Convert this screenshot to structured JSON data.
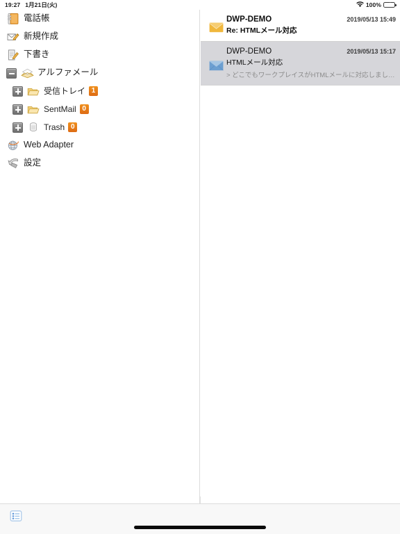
{
  "statusbar": {
    "time": "19:27",
    "date": "1月21日(火)",
    "wifi_icon": "wifi-icon",
    "battery_percent": "100%",
    "battery_icon": "battery-charging-icon"
  },
  "sidebar": {
    "items": [
      {
        "label": "電話帳",
        "icon": "address-book-icon",
        "level": 1,
        "disclosure": null,
        "badge": null
      },
      {
        "label": "新規作成",
        "icon": "compose-mail-icon",
        "level": 1,
        "disclosure": null,
        "badge": null
      },
      {
        "label": "下書き",
        "icon": "draft-icon",
        "level": 1,
        "disclosure": null,
        "badge": null
      },
      {
        "label": "アルファメール",
        "icon": "account-mail-icon",
        "level": 1,
        "disclosure": "minus",
        "badge": null
      },
      {
        "label": "受信トレイ",
        "icon": "folder-icon",
        "level": 2,
        "disclosure": "plus",
        "badge": "1"
      },
      {
        "label": "SentMail",
        "icon": "folder-icon",
        "level": 2,
        "disclosure": "plus",
        "badge": "0"
      },
      {
        "label": "Trash",
        "icon": "trash-can-icon",
        "level": 2,
        "disclosure": "plus",
        "badge": "0"
      },
      {
        "label": "Web Adapter",
        "icon": "globe-icon",
        "level": 1,
        "disclosure": null,
        "badge": null
      },
      {
        "label": "設定",
        "icon": "settings-arrow-icon",
        "level": 1,
        "disclosure": null,
        "badge": null
      }
    ]
  },
  "mail_list": {
    "messages": [
      {
        "from": "DWP-DEMO",
        "subject": "Re: HTMLメール対応",
        "date": "2019/05/13 15:49",
        "preview": "",
        "icon": "envelope-unread-icon",
        "selected": false
      },
      {
        "from": "DWP-DEMO",
        "subject": "HTMLメール対応",
        "date": "2019/05/13 15:17",
        "preview": "> どこでもワークプレイスがHTMLメールに対応しまし…",
        "icon": "envelope-read-icon",
        "selected": true
      }
    ]
  },
  "toolbar": {
    "list_button_icon": "list-view-icon"
  },
  "colors": {
    "badge_orange": "#dd6b14",
    "selection_gray": "#d6d6da",
    "battery_green": "#34c759",
    "folder_yellow": "#f2c14a",
    "envelope_blue": "#5b8fc9"
  }
}
